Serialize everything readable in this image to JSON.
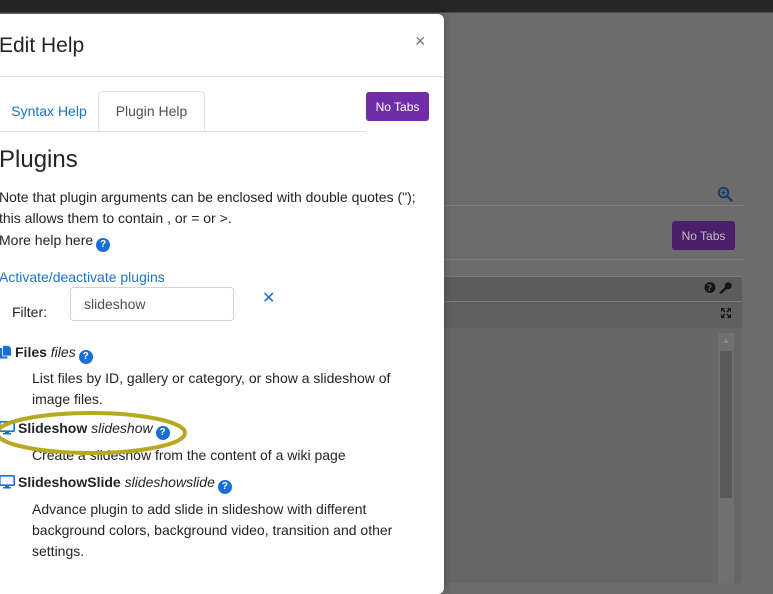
{
  "background": {
    "no_tabs_label": "No Tabs"
  },
  "modal": {
    "title": "Edit Help",
    "close_glyph": "×",
    "no_tabs_label": "No Tabs",
    "tabs": [
      {
        "label": "Syntax Help",
        "active": false
      },
      {
        "label": "Plugin Help",
        "active": true
      }
    ],
    "heading": "Plugins",
    "note": "Note that plugin arguments can be enclosed with double quotes (\"); this allows them to contain , or = or >.",
    "more_help": "More help here",
    "activate_link": "Activate/deactivate plugins",
    "filter_label": "Filter:",
    "filter_value": "slideshow",
    "clear_glyph": "✕",
    "plugins": [
      {
        "name": "Files",
        "id": "files",
        "icon": "files-icon",
        "description": "List files by ID, gallery or category, or show a slideshow of image files."
      },
      {
        "name": "Slideshow",
        "id": "slideshow",
        "icon": "desktop-icon",
        "description": "Create a slideshow from the content of a wiki page",
        "circled": true
      },
      {
        "name": "SlideshowSlide",
        "id": "slideshowslide",
        "icon": "desktop-icon",
        "description": "Advance plugin to add slide in slideshow with different background colors, background video, transition and other settings."
      }
    ]
  },
  "colors": {
    "accent_purple": "#6f2da8",
    "link_blue": "#1a73c8",
    "highlight_ellipse": "#b8a81e"
  }
}
